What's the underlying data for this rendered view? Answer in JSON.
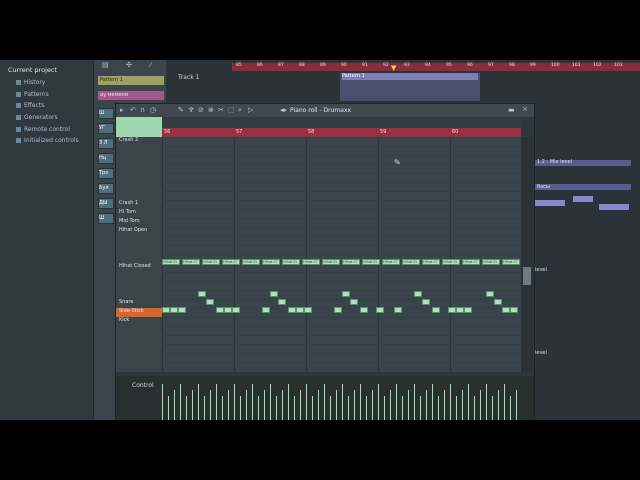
{
  "browser": {
    "header": "Current project",
    "items": [
      "History",
      "Patterns",
      "Effects",
      "Generators",
      "Remote control",
      "Initialized controls"
    ]
  },
  "channel_rack": {
    "patterns": [
      "Pattern 1",
      "ау мемекм"
    ],
    "channel_buttons": [
      "Ш",
      "УГ",
      "3 Л",
      "Нц",
      "Трэ",
      "Бул",
      "ДЫ",
      "Ш"
    ]
  },
  "playlist": {
    "track_label": "Track 1",
    "pattern_clip": "Pattern 1",
    "ruler_numbers": [
      "85",
      "86",
      "87",
      "88",
      "89",
      "90",
      "91",
      "92",
      "93",
      "94",
      "95",
      "96",
      "97",
      "98",
      "99",
      "100",
      "101",
      "102",
      "103"
    ],
    "right_labels": [
      "1.2 - Mix level",
      "басы",
      "level",
      "level"
    ]
  },
  "piano_roll": {
    "title": "Piano roll - Drumaxx",
    "ruler_numbers": [
      "56",
      "57",
      "58",
      "59",
      "60"
    ],
    "keys": [
      {
        "label": "Crash 2",
        "row": 0
      },
      {
        "label": "Crash 1",
        "row": 2
      },
      {
        "label": "Hi Tom",
        "row": 3
      },
      {
        "label": "Mid Tom",
        "row": 4
      },
      {
        "label": "Hihat Open",
        "row": 5
      },
      {
        "label": "Hihat Closed",
        "row": 9
      },
      {
        "label": "Snare",
        "row": 13
      },
      {
        "label": "Side-Stick",
        "row": 14
      },
      {
        "label": "Kick",
        "row": 15
      }
    ],
    "note_label": "Hihat Cl",
    "control_label": "Control"
  },
  "colors": {
    "accent_ruler": "#9a3040",
    "note_fill": "#a9e3b7",
    "selected_key": "#d8642a"
  }
}
